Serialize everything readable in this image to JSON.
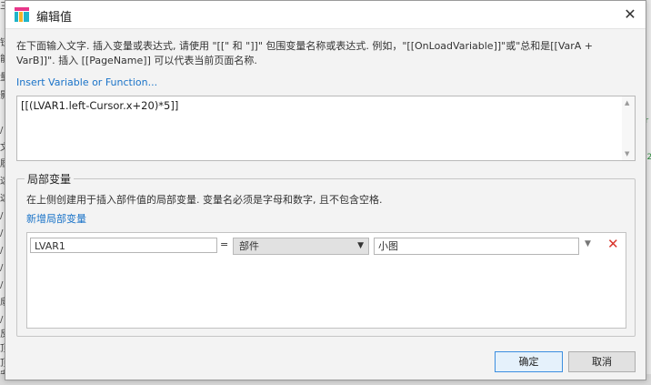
{
  "background": {
    "left_fragments": [
      "三",
      "钮",
      "能",
      "量",
      "影",
      "/",
      "文",
      "履",
      "这",
      "这",
      "/",
      "/",
      "/",
      "/",
      "/",
      "扇",
      "/",
      "反",
      "顶",
      "顶",
      "安"
    ],
    "right_fragments": [
      "or",
      "=2"
    ]
  },
  "dialog": {
    "title": "编辑值",
    "close_glyph": "✕",
    "instructions": "在下面输入文字. 插入变量或表达式, 请使用 \"[[\" 和 \"]]\" 包围变量名称或表达式. 例如，\"[[OnLoadVariable]]\"或\"总和是[[VarA + VarB]]\". 插入 [[PageName]] 可以代表当前页面名称.",
    "insert_link": "Insert Variable or Function...",
    "expression": "[[(LVAR1.left-Cursor.x+20)*5]]"
  },
  "local_vars": {
    "legend": "局部变量",
    "description": "在上侧创建用于插入部件值的局部变量. 变量名必须是字母和数字, 且不包含空格.",
    "add_link": "新增局部变量",
    "rows": [
      {
        "name": "LVAR1",
        "equals": "=",
        "kind": "部件",
        "target": "小图"
      }
    ]
  },
  "buttons": {
    "ok": "确定",
    "cancel": "取消"
  },
  "colors": {
    "link": "#1a73c8",
    "delete": "#d9342b",
    "ok_border": "#3b8ee0"
  }
}
